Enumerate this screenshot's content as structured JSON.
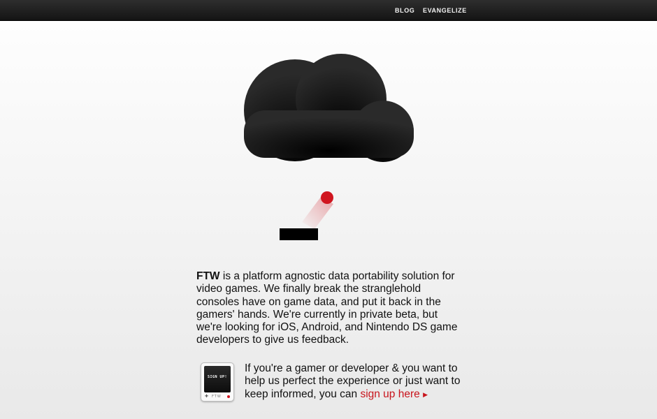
{
  "nav": {
    "blog_label": "BLOG",
    "evangelize_label": "EVANGELIZE"
  },
  "hero": {
    "icons": [
      "cloud-icon",
      "ball-icon",
      "paddle-icon"
    ],
    "colors": {
      "cloud": "#141414",
      "ball": "#d0151f",
      "paddle": "#000000"
    }
  },
  "intro": {
    "brand": "FTW",
    "text": " is a platform agnostic data portability solution for video games. We finally break the stranglehold consoles have on game data, and put it back in the gamers' hands. We're currently in private beta, but we're looking for iOS, Android, and Nintendo DS game developers to give us feedback."
  },
  "signup_device": {
    "screen_text": "SIGN UP!",
    "dpad_icon": "dpad-icon",
    "brand": "FTW"
  },
  "cta": {
    "text": "If you're a gamer or developer & you want to help us perfect the experience or just want to keep informed, you can ",
    "link_label": "sign up here",
    "arrow": "▶",
    "link_color": "#c8141c"
  }
}
